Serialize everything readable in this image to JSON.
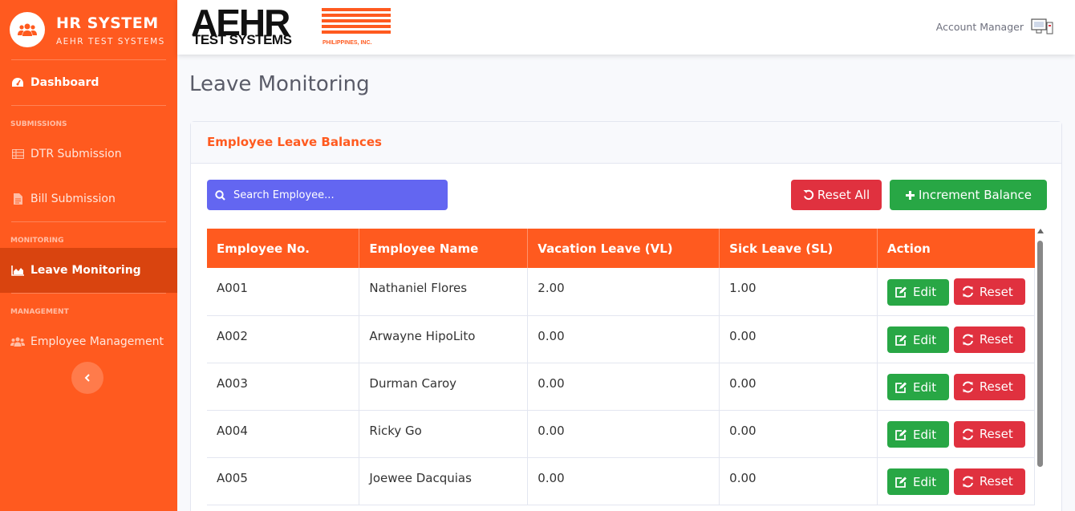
{
  "sidebar": {
    "brand_title": "HR SYSTEM",
    "brand_subtitle": "AEHR TEST SYSTEMS",
    "dashboard": "Dashboard",
    "heading_submissions": "SUBMISSIONS",
    "dtr_submission": "DTR Submission",
    "bill_submission": "Bill Submission",
    "heading_monitoring": "MONITORING",
    "leave_monitoring": "Leave Monitoring",
    "heading_management": "MANAGEMENT",
    "employee_management": "Employee Management"
  },
  "topbar": {
    "logo_main": "AEHR",
    "logo_sub": "TEST SYSTEMS",
    "logo_ph": "PHILIPPINES, INC.",
    "account_label": "Account Manager"
  },
  "page": {
    "title": "Leave Monitoring",
    "card_title": "Employee Leave Balances",
    "search_placeholder": "Search Employee...",
    "reset_all_label": "Reset All",
    "increment_label": "Increment Balance",
    "edit_label": "Edit",
    "reset_label": "Reset"
  },
  "table": {
    "headers": [
      "Employee No.",
      "Employee Name",
      "Vacation Leave (VL)",
      "Sick Leave (SL)",
      "Action"
    ],
    "rows": [
      [
        "A001",
        "Nathaniel Flores",
        "2.00",
        "1.00"
      ],
      [
        "A002",
        "Arwayne HipoLito",
        "0.00",
        "0.00"
      ],
      [
        "A003",
        "Durman Caroy",
        "0.00",
        "0.00"
      ],
      [
        "A004",
        "Ricky Go",
        "0.00",
        "0.00"
      ],
      [
        "A005",
        "Joewee Dacquias",
        "0.00",
        "0.00"
      ]
    ]
  },
  "colors": {
    "primary": "#ff5a1f",
    "active_nav": "#d9440f",
    "search_bg": "#6366f1",
    "success": "#28a745",
    "danger": "#e0313f"
  }
}
